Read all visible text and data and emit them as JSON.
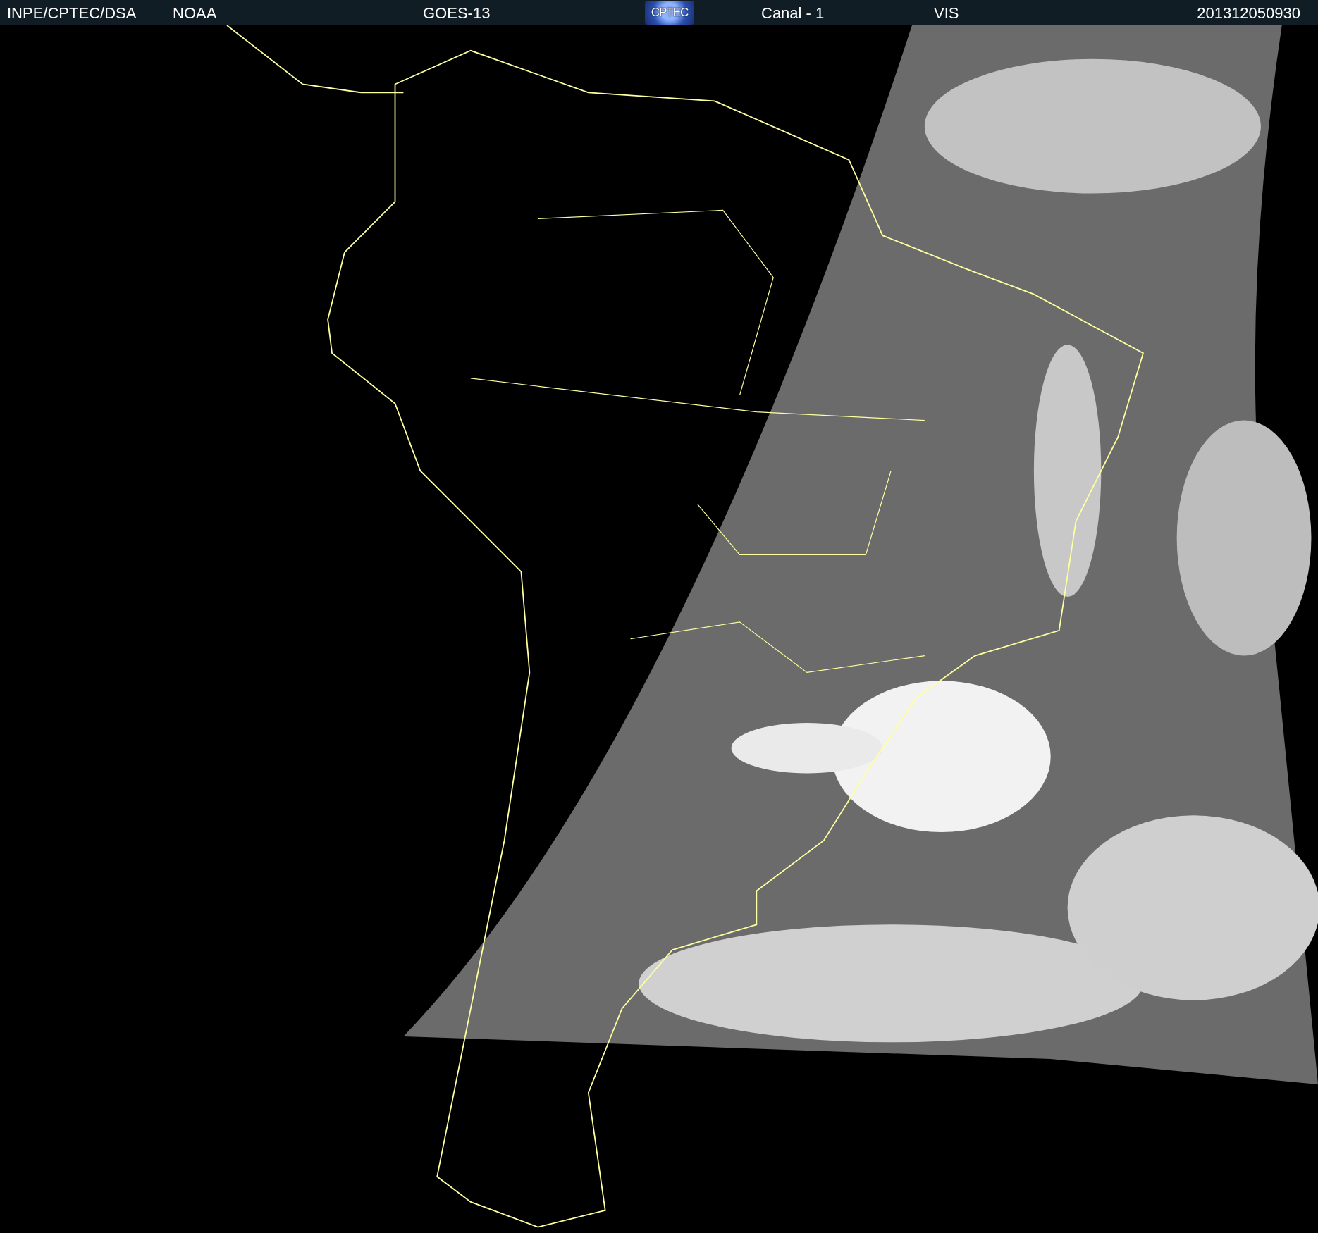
{
  "header": [
    {
      "kind": "text",
      "text": "INPE/CPTEC/DSA"
    },
    {
      "kind": "text",
      "text": "NOAA"
    },
    {
      "kind": "text",
      "text": "GOES-13"
    },
    {
      "kind": "logo",
      "text": "CPTEC"
    },
    {
      "kind": "text",
      "text": "Canal - 1"
    },
    {
      "kind": "text",
      "text": "VIS"
    },
    {
      "kind": "text",
      "text": "201312050930"
    }
  ]
}
